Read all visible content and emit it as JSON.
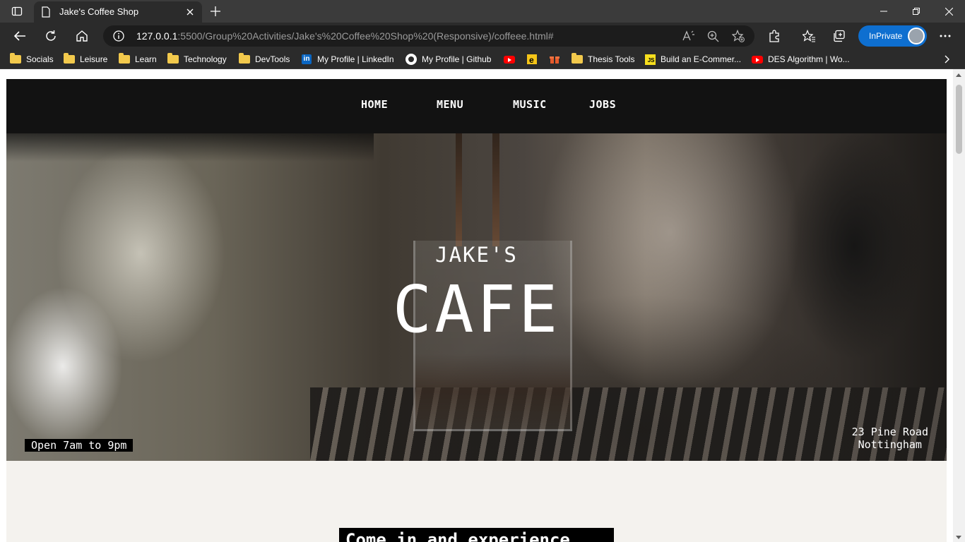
{
  "browser": {
    "tab_title": "Jake's Coffee Shop",
    "url_host": "127.0.0.1",
    "url_rest": ":5500/Group%20Activities/Jake's%20Coffee%20Shop%20(Responsive)/coffeee.html#",
    "inprivate_label": "InPrivate",
    "bookmarks": [
      {
        "label": "Socials",
        "icon": "folder-icon"
      },
      {
        "label": "Leisure",
        "icon": "folder-icon"
      },
      {
        "label": "Learn",
        "icon": "folder-icon"
      },
      {
        "label": "Technology",
        "icon": "folder-icon"
      },
      {
        "label": "DevTools",
        "icon": "folder-icon"
      },
      {
        "label": "My Profile | LinkedIn",
        "icon": "linkedin-icon"
      },
      {
        "label": "My Profile | Github",
        "icon": "github-icon"
      },
      {
        "label": "",
        "icon": "youtube-icon"
      },
      {
        "label": "",
        "icon": "bookmark-e-icon"
      },
      {
        "label": "",
        "icon": "bookmark-gift-icon"
      },
      {
        "label": "Thesis Tools",
        "icon": "folder-icon"
      },
      {
        "label": "Build an E-Commer...",
        "icon": "js-icon"
      },
      {
        "label": "DES Algorithm | Wo...",
        "icon": "youtube-icon"
      }
    ]
  },
  "site": {
    "nav": [
      "HOME",
      "MENU",
      "MUSIC",
      "JOBS"
    ],
    "hero_sub": "JAKE'S",
    "hero_title": "CAFE",
    "hours": "Open 7am to 9pm",
    "address_line1": "23 Pine Road",
    "address_line2": "Nottingham",
    "tagline": "Come in and experience"
  },
  "colors": {
    "chrome_dark": "#2b2b2b",
    "inprivate_blue": "#0e6fd0",
    "site_nav": "#121212",
    "page_bg": "#f4f2ee"
  }
}
